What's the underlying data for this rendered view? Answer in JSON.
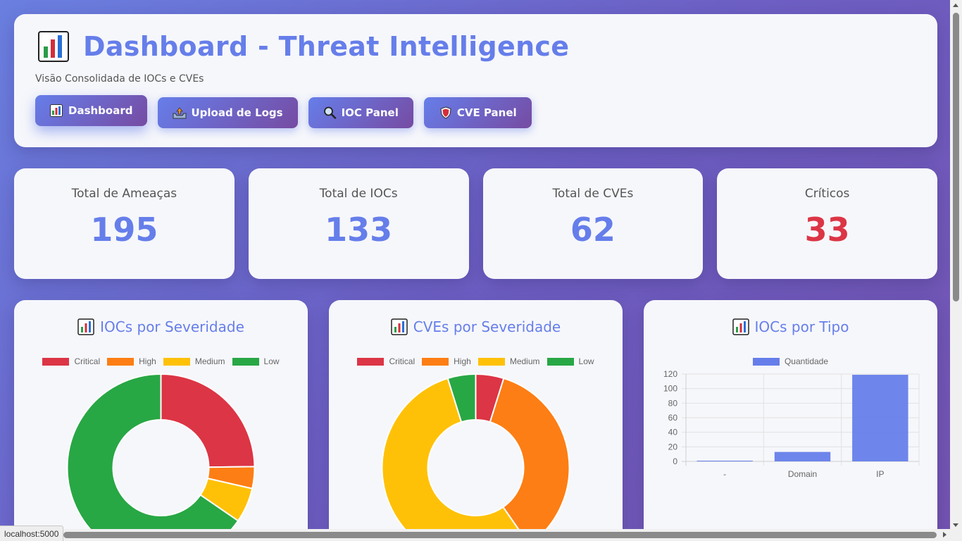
{
  "header": {
    "title": "Dashboard - Threat Intelligence",
    "title_icon": "bar-chart-icon",
    "subtitle": "Visão Consolidada de IOCs e CVEs",
    "nav": [
      {
        "label": "Dashboard",
        "icon": "bar-chart-icon",
        "active": true
      },
      {
        "label": "Upload de Logs",
        "icon": "upload-tray-icon",
        "active": false
      },
      {
        "label": "IOC Panel",
        "icon": "magnifier-icon",
        "active": false
      },
      {
        "label": "CVE Panel",
        "icon": "shield-icon",
        "active": false
      }
    ]
  },
  "stats": [
    {
      "label": "Total de Ameaças",
      "value": "195",
      "color": "#667eea"
    },
    {
      "label": "Total de IOCs",
      "value": "133",
      "color": "#667eea"
    },
    {
      "label": "Total de CVEs",
      "value": "62",
      "color": "#667eea"
    },
    {
      "label": "Críticos",
      "value": "33",
      "color": "#dc3545"
    }
  ],
  "colors": {
    "accent": "#667eea",
    "critical": "#dc3545",
    "high": "#fd7e14",
    "medium": "#ffc107",
    "low": "#28a745"
  },
  "charts": {
    "ioc_severity_title": "IOCs por Severidade",
    "cve_severity_title": "CVEs por Severidade",
    "ioc_type_title": "IOCs por Tipo"
  },
  "chart_data": [
    {
      "type": "pie",
      "title": "IOCs por Severidade",
      "categories": [
        "Critical",
        "High",
        "Medium",
        "Low"
      ],
      "values": [
        33,
        5,
        8,
        87
      ],
      "colors": [
        "#dc3545",
        "#fd7e14",
        "#ffc107",
        "#28a745"
      ],
      "legend": "top"
    },
    {
      "type": "pie",
      "title": "CVEs por Severidade",
      "categories": [
        "Critical",
        "High",
        "Medium",
        "Low"
      ],
      "values": [
        3,
        22,
        34,
        3
      ],
      "colors": [
        "#dc3545",
        "#fd7e14",
        "#ffc107",
        "#28a745"
      ],
      "legend": "top"
    },
    {
      "type": "bar",
      "title": "IOCs por Tipo",
      "categories": [
        "-",
        "Domain",
        "IP"
      ],
      "series": [
        {
          "name": "Quantidade",
          "values": [
            1,
            13,
            119
          ]
        }
      ],
      "ylim": [
        0,
        120
      ],
      "yticks": [
        0,
        20,
        40,
        60,
        80,
        100,
        120
      ],
      "color": "#667eea",
      "grid": true,
      "legend": "top"
    }
  ],
  "status_bar": {
    "url": "localhost:5000"
  }
}
